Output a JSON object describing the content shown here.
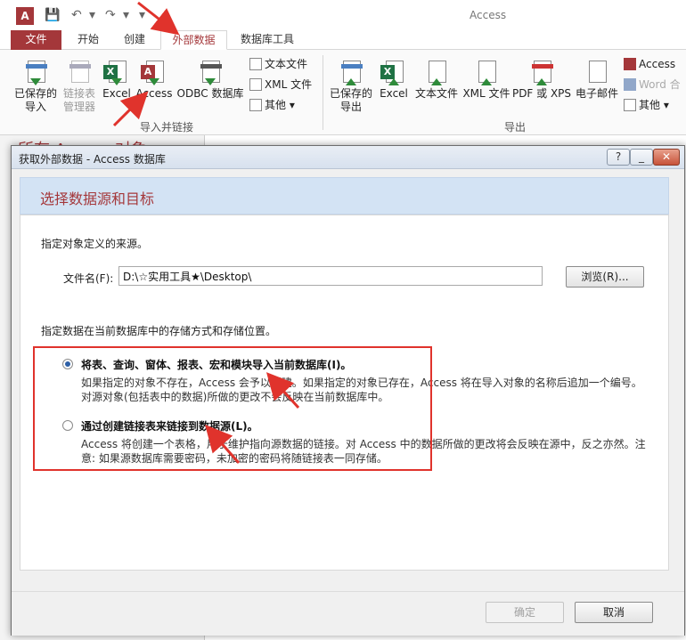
{
  "window": {
    "title": "Access",
    "app_icon": "access-icon",
    "quick_access": {
      "save": "save-icon",
      "undo": "undo-icon",
      "redo": "redo-icon",
      "customize": "customize-qat-icon"
    }
  },
  "tabs": {
    "file": "文件",
    "home": "开始",
    "create": "创建",
    "external_data": "外部数据",
    "db_tools": "数据库工具"
  },
  "ribbon": {
    "import_group": {
      "label": "导入并链接",
      "saved_imports": [
        "已保存的",
        "导入"
      ],
      "linked_table_manager": [
        "链接表",
        "管理器"
      ],
      "excel": "Excel",
      "access": "Access",
      "odbc": "ODBC 数据库",
      "text_file": "文本文件",
      "xml_file": "XML 文件",
      "more": "其他"
    },
    "export_group": {
      "label": "导出",
      "saved_exports": [
        "已保存的",
        "导出"
      ],
      "excel": "Excel",
      "text_file": "文本文件",
      "xml_file": "XML 文件",
      "pdf_xps": "PDF 或 XPS",
      "email": "电子邮件",
      "access": "Access",
      "word_merge": "Word 合",
      "more": "其他"
    }
  },
  "nav_pane": {
    "title": "所有 Access 对象"
  },
  "dialog": {
    "title": "获取外部数据 - Access 数据库",
    "help_button": "?",
    "close_button": "✕",
    "header": "选择数据源和目标",
    "source_prompt": "指定对象定义的来源。",
    "filename_label": "文件名(F):",
    "filename_value": "D:\\☆实用工具★\\Desktop\\",
    "browse_button": "浏览(R)...",
    "storage_prompt": "指定数据在当前数据库中的存储方式和存储位置。",
    "option_import": {
      "selected": true,
      "title": "将表、查询、窗体、报表、宏和模块导入当前数据库(I)。",
      "description": "如果指定的对象不存在，Access 会予以创建。如果指定的对象已存在，Access 将在导入对象的名称后追加一个编号。对源对象(包括表中的数据)所做的更改不会反映在当前数据库中。"
    },
    "option_link": {
      "selected": false,
      "title": "通过创建链接表来链接到数据源(L)。",
      "description": "Access 将创建一个表格，用于维护指向源数据的链接。对 Access 中的数据所做的更改将会反映在源中，反之亦然。注意: 如果源数据库需要密码，未加密的密码将随链接表一同存储。"
    },
    "ok_button": "确定",
    "cancel_button": "取消"
  },
  "annotation_color": "#e0332c"
}
